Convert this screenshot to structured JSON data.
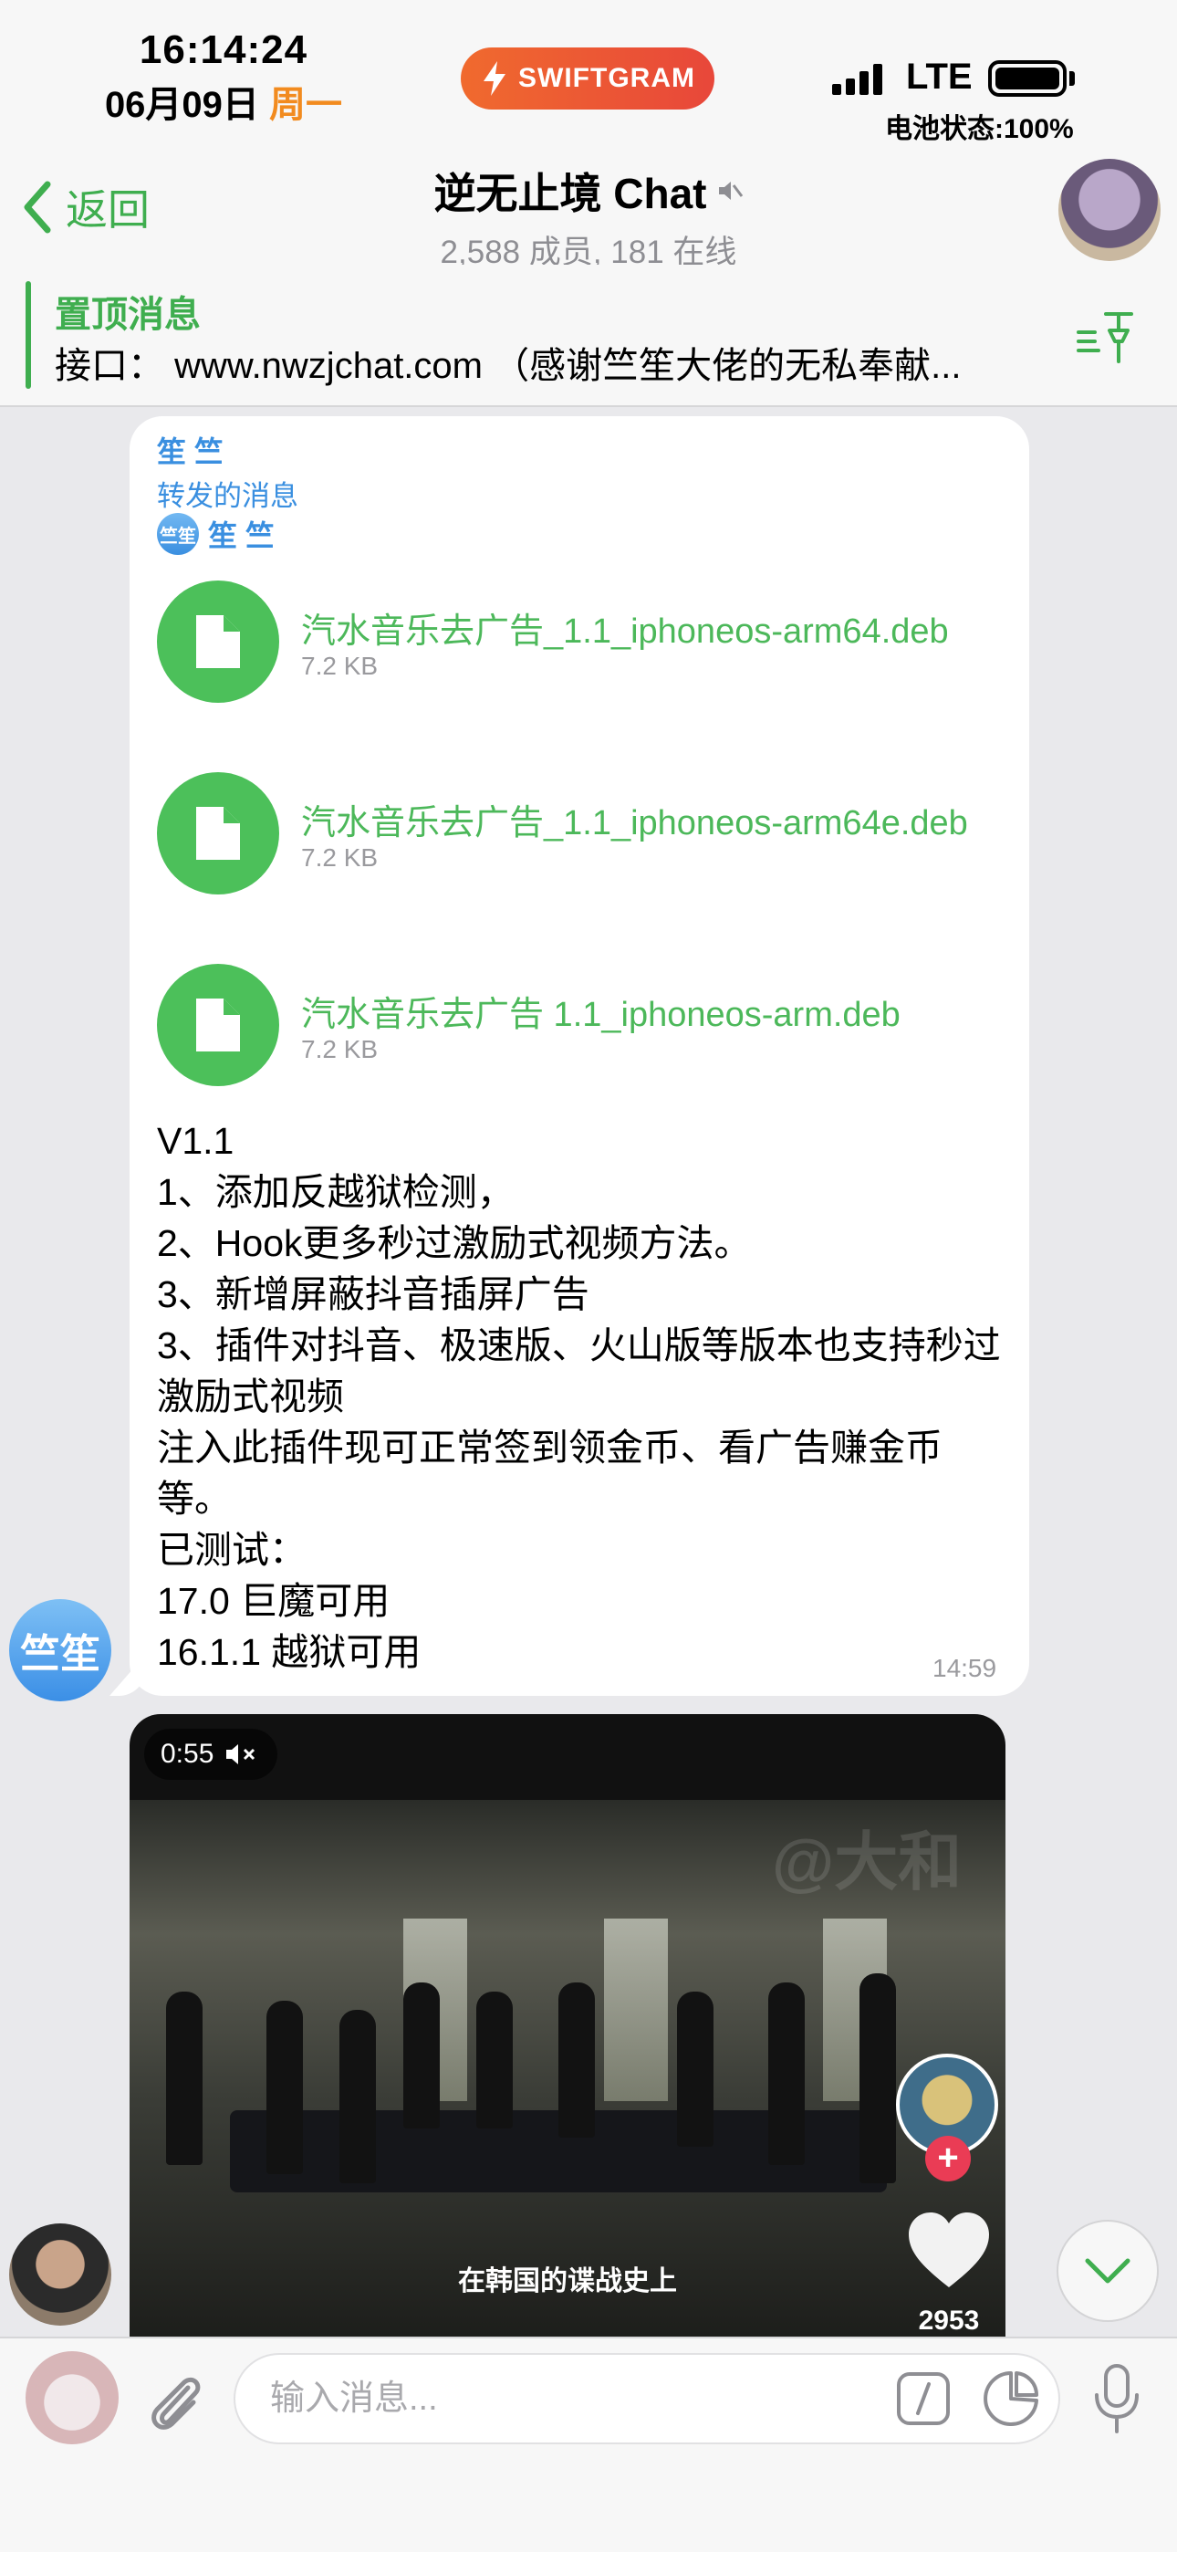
{
  "status_bar": {
    "time": "16:14:24",
    "date": "06月09日",
    "weekday": "周一",
    "app_badge": "SWIFTGRAM",
    "network": "LTE",
    "battery_text": "电池状态:100%",
    "battery_level": 1.0
  },
  "nav": {
    "back_label": "返回",
    "title": "逆无止境 Chat",
    "subtitle": "2,588 成员, 181 在线",
    "muted": true
  },
  "pinned": {
    "title": "置顶消息",
    "text": "接口： www.nwzjchat.com （感谢竺笙大佬的无私奉献..."
  },
  "message": {
    "sender": "笙 竺",
    "forward_label": "转发的消息",
    "forward_from": "笙 竺",
    "forward_avatar_text": "竺笙",
    "files": [
      {
        "name": "汽水音乐去广告_1.1_iphoneos-arm64.deb",
        "size": "7.2 KB"
      },
      {
        "name": "汽水音乐去广告_1.1_iphoneos-arm64e.deb",
        "size": "7.2 KB"
      },
      {
        "name": "汽水音乐去广告 1.1_iphoneos-arm.deb",
        "size": "7.2 KB"
      }
    ],
    "lines": [
      "V1.1",
      "1、添加反越狱检测，",
      "2、Hook更多秒过激励式视频方法。",
      "3、新增屏蔽抖音插屏广告",
      "3、插件对抖音、极速版、火山版等版本也支持秒过激励式视频",
      "注入此插件现可正常签到领金币、看广告赚金币等。",
      "已测试：",
      "17.0 巨魔可用",
      "16.1.1 越狱可用"
    ],
    "time": "14:59",
    "sender_avatar_text": "竺笙"
  },
  "video": {
    "duration": "0:55",
    "watermark": "@大和",
    "caption": "在韩国的谍战史上",
    "like_count": "2953"
  },
  "input": {
    "placeholder": "输入消息..."
  },
  "colors": {
    "accent_green": "#3fae4f",
    "link_blue": "#3a8fe0",
    "weekday_orange": "#f28b1f"
  }
}
